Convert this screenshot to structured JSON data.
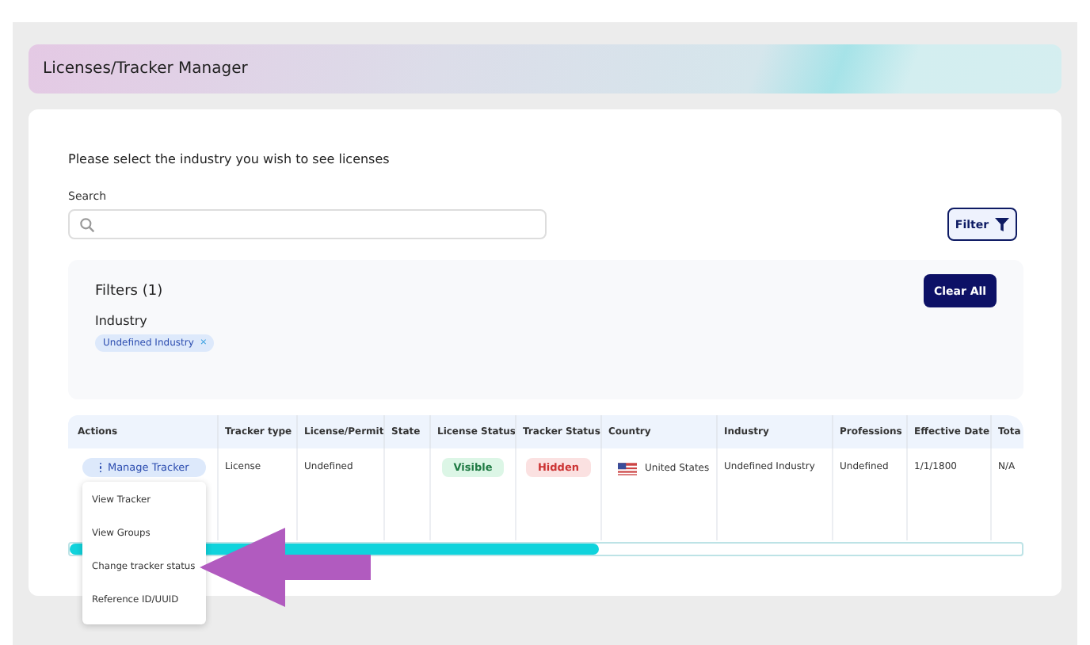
{
  "header": {
    "title": "Licenses/Tracker Manager"
  },
  "prompt": "Please select the industry you wish to see licenses",
  "search": {
    "label": "Search"
  },
  "filter_button": {
    "label": "Filter"
  },
  "filters": {
    "title": "Filters (1)",
    "clear_label": "Clear All",
    "group_label": "Industry",
    "chips": [
      {
        "label": "Undefined Industry",
        "remove": "×"
      }
    ]
  },
  "table": {
    "columns": [
      "Actions",
      "Tracker type",
      "License/Permit",
      "State",
      "License Status",
      "Tracker Status",
      "Country",
      "Industry",
      "Professions",
      "Effective Date",
      "Tota"
    ],
    "rows": [
      {
        "action": "Manage Tracker",
        "tracker_type": "License",
        "license_permit": "Undefined",
        "state": "",
        "license_status": {
          "label": "Visible",
          "kind": "visible"
        },
        "tracker_status": {
          "label": "Hidden",
          "kind": "hidden"
        },
        "country": "United States",
        "industry": "Undefined Industry",
        "professions": "Undefined",
        "effective_date": "1/1/1800",
        "total": "N/A"
      }
    ]
  },
  "menu": {
    "items": [
      {
        "label": "View Tracker"
      },
      {
        "label": "View Groups"
      },
      {
        "label": "Change tracker status"
      },
      {
        "label": "Reference ID/UUID"
      }
    ]
  }
}
